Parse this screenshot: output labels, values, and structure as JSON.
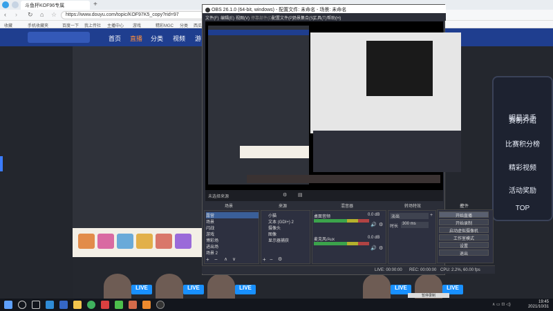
{
  "browser": {
    "tabs": [
      "斗鱼杯KOF96专属"
    ],
    "url": "https://www.douyu.com/topic/KOF97K5_copy?rid=97",
    "bookmarks": [
      "收藏",
      "手机收藏夹",
      "百度一下",
      "我上传社",
      "主播中心",
      "游戏",
      "精彩MGC",
      "分类",
      "西瓜"
    ]
  },
  "site": {
    "nav": [
      "首页",
      "直播",
      "分类",
      "视频",
      "游"
    ],
    "right_panel": [
      "明星选手",
      "赛制介绍",
      "比赛积分榜",
      "精彩视频",
      "活动奖励",
      "TOP"
    ],
    "live_badge": "LIVE"
  },
  "obs": {
    "title": "OBS 26.1.0 (64-bit, windows) - 配置文件: 未命名 - 场景: 未命名",
    "menu": [
      "文件(F)",
      "编辑(E)",
      "视图(V)",
      "停靠部件(D)",
      "配置文件(P)",
      "场景集合(S)",
      "工具(T)",
      "帮助(H)"
    ],
    "dock_titles": [
      "场景",
      "来源",
      "混音器",
      "转场特效",
      "控件"
    ],
    "scenes": [
      "露营",
      "场景",
      "闪战",
      "游戏",
      "博彩场",
      "进出场",
      "场景 2"
    ],
    "sources": [
      "小猫",
      "文本 (GDI+) 2",
      "摄像头",
      "图像",
      "显示器捕获"
    ],
    "mixer": [
      {
        "name": "桌面音频",
        "level": "0.0 dB"
      },
      {
        "name": "麦克风/Aux",
        "level": "0.0 dB"
      }
    ],
    "transition": {
      "type": "淡出",
      "duration_label": "时长",
      "duration": "300 ms"
    },
    "controls": [
      "开始直播",
      "开始录制",
      "启动虚拟摄像机",
      "工作室模式",
      "设置",
      "退出"
    ],
    "status": {
      "live": "LIVE: 00:00:00",
      "rec": "REC: 00:00:00",
      "cpu": "CPU: 2.2%, 60.00 fps"
    },
    "preview_bar_text": "未选择来源"
  },
  "taskbar": {
    "time": "19:45",
    "date": "2021/10/31",
    "notify": "暂停录制"
  },
  "colors": {
    "site_nav": "#1f3e8f",
    "obs_bg": "#2b2e38",
    "live_badge": "#1890ff"
  }
}
